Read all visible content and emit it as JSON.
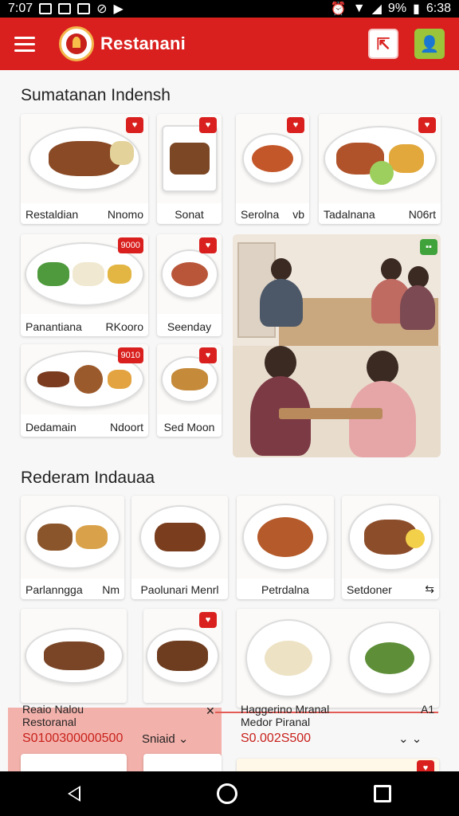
{
  "status_bar": {
    "time": "7:07",
    "battery": "9%",
    "clock_right": "6:38"
  },
  "app": {
    "title": "Restanani",
    "colors": {
      "primary": "#d9201e",
      "accent": "#9bc43a"
    }
  },
  "sections": [
    {
      "title": "Sumatanan Indensh",
      "items": [
        {
          "name": "Restaldian",
          "extra": "Nnomo"
        },
        {
          "name": "Sonat",
          "extra": ""
        },
        {
          "name": "Serolna",
          "extra": "vb"
        },
        {
          "name": "Tadalnana",
          "extra": "N06rt"
        },
        {
          "name": "Panantiana",
          "extra": "RKooro"
        },
        {
          "name": "Seenday",
          "extra": ""
        },
        {
          "name": "Dedamain",
          "extra": "Ndoort"
        },
        {
          "name": "Sed Moon",
          "extra": ""
        }
      ],
      "badges": {
        "b1": "9000",
        "b2": "9010",
        "b3": "9000"
      }
    },
    {
      "title": "Rederam Indauaa",
      "items": [
        {
          "name": "Parlanngga",
          "extra": "Nm"
        },
        {
          "name": "Paolunari Menrl",
          "extra": ""
        },
        {
          "name": "Petrdalna",
          "extra": ""
        },
        {
          "name": "Setdoner",
          "extra": ""
        }
      ]
    }
  ],
  "bottom_cards": {
    "left": {
      "title": "Reaio Nalou",
      "subtitle": "Restoranal",
      "price": "S0100300000500",
      "select_label": "Sniaid"
    },
    "right": {
      "title": "Haggerino Mranal",
      "subtitle": "Medor Piranal",
      "price": "S0.002S500",
      "suffix": "A1"
    }
  }
}
